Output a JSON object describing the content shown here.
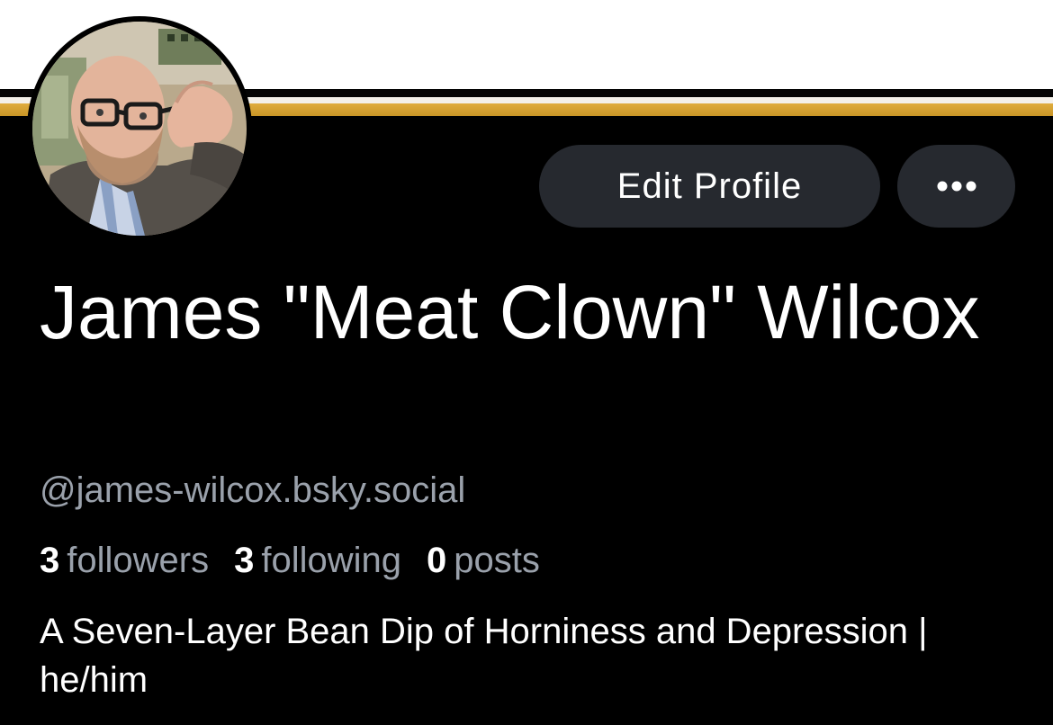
{
  "colors": {
    "background": "#000000",
    "button_background": "#26292f",
    "banner_gold": "#d9a433",
    "secondary_text": "#9aa1ab"
  },
  "banner": {
    "description": "white banner with black, cream and gold stripes"
  },
  "avatar": {
    "icon": "profile-photo"
  },
  "actions": {
    "edit_profile_label": "Edit Profile",
    "more_icon": "ellipsis-icon"
  },
  "profile": {
    "display_name": "James \"Meat Clown\" Wilcox",
    "handle": "@james-wilcox.bsky.social",
    "bio": "A Seven-Layer Bean Dip of Horniness and Depression | he/him"
  },
  "stats": {
    "followers_count": "3",
    "followers_label": "followers",
    "following_count": "3",
    "following_label": "following",
    "posts_count": "0",
    "posts_label": "posts"
  }
}
